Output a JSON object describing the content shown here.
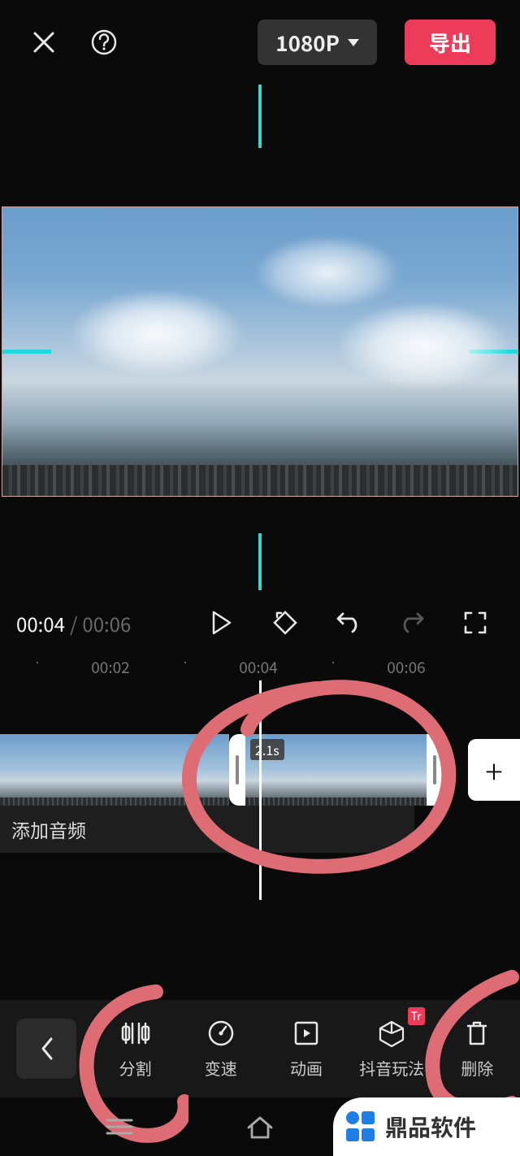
{
  "header": {
    "resolution": "1080P",
    "export": "导出"
  },
  "transport": {
    "current": "00:04",
    "total": "00:06"
  },
  "ruler": {
    "t1": "00:02",
    "t2": "00:04",
    "t3": "00:06"
  },
  "timeline": {
    "clip2_duration": "2.1s",
    "add_audio": "添加音频",
    "add_clip": "+"
  },
  "tools": {
    "split": "分割",
    "speed": "变速",
    "animation": "动画",
    "douyin": "抖音玩法",
    "douyin_badge": "Tr",
    "delete": "删除"
  },
  "watermark": "鼎品软件"
}
